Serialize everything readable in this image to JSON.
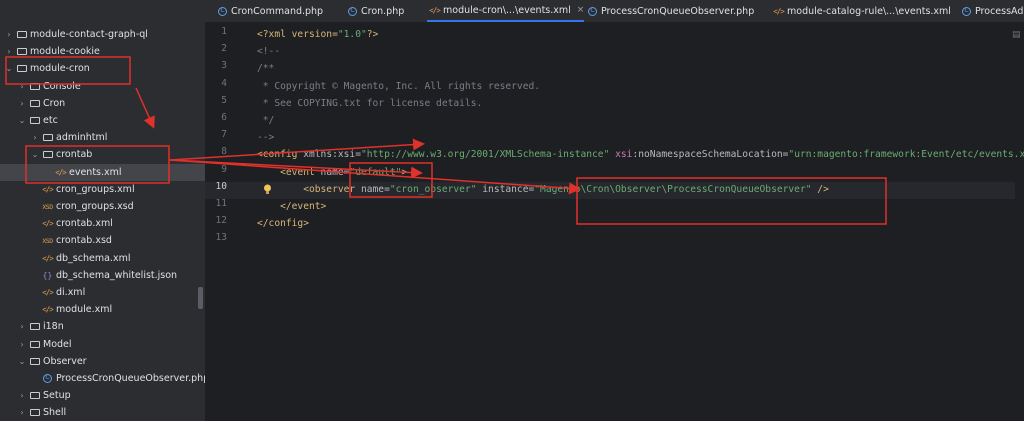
{
  "project_tree": {
    "items": [
      {
        "label": "module-contact-graph-ql",
        "type": "folder",
        "chevron": "›"
      },
      {
        "label": "module-cookie",
        "type": "folder",
        "chevron": "›"
      },
      {
        "label": "module-cron",
        "type": "folder",
        "chevron": "⌄"
      },
      {
        "label": "Console",
        "type": "folder",
        "chevron": "›"
      },
      {
        "label": "Cron",
        "type": "folder",
        "chevron": "›"
      },
      {
        "label": "etc",
        "type": "folder",
        "chevron": "⌄"
      },
      {
        "label": "adminhtml",
        "type": "folder",
        "chevron": "›"
      },
      {
        "label": "crontab",
        "type": "folder",
        "chevron": "⌄"
      },
      {
        "label": "events.xml",
        "type": "xml",
        "chevron": ""
      },
      {
        "label": "cron_groups.xml",
        "type": "xml",
        "chevron": ""
      },
      {
        "label": "cron_groups.xsd",
        "type": "xsd",
        "chevron": ""
      },
      {
        "label": "crontab.xml",
        "type": "xml",
        "chevron": ""
      },
      {
        "label": "crontab.xsd",
        "type": "xsd",
        "chevron": ""
      },
      {
        "label": "db_schema.xml",
        "type": "xml",
        "chevron": ""
      },
      {
        "label": "db_schema_whitelist.json",
        "type": "json",
        "chevron": ""
      },
      {
        "label": "di.xml",
        "type": "xml",
        "chevron": ""
      },
      {
        "label": "module.xml",
        "type": "xml",
        "chevron": ""
      },
      {
        "label": "i18n",
        "type": "folder",
        "chevron": "›"
      },
      {
        "label": "Model",
        "type": "folder",
        "chevron": "›"
      },
      {
        "label": "Observer",
        "type": "folder",
        "chevron": "⌄"
      },
      {
        "label": "ProcessCronQueueObserver.php",
        "type": "class",
        "chevron": ""
      },
      {
        "label": "Setup",
        "type": "folder",
        "chevron": "›"
      },
      {
        "label": "Shell",
        "type": "folder",
        "chevron": "›"
      }
    ],
    "selected_index": 8
  },
  "tabs": [
    {
      "label": "CronCommand.php",
      "icon": "class",
      "active": false
    },
    {
      "label": "Cron.php",
      "icon": "class",
      "active": false
    },
    {
      "label": "module-cron\\...\\events.xml",
      "icon": "xml",
      "active": true,
      "close": "×"
    },
    {
      "label": "ProcessCronQueueObserver.php",
      "icon": "class",
      "active": false
    },
    {
      "label": "module-catalog-rule\\...\\events.xml",
      "icon": "xml",
      "active": false
    },
    {
      "label": "ProcessAdm",
      "icon": "class",
      "active": false
    }
  ],
  "icons": {
    "xml": "</>",
    "xsd": "XSD",
    "json": "{}",
    "class": "C",
    "bulb": "lightbulb-icon"
  },
  "editor": {
    "current_line": 10,
    "line_numbers": [
      "1",
      "2",
      "3",
      "4",
      "5",
      "6",
      "7",
      "8",
      "9",
      "10",
      "11",
      "12",
      "13"
    ],
    "lines": [
      [
        {
          "t": "<?xml version=",
          "c": "tag"
        },
        {
          "t": "\"1.0\"",
          "c": "val"
        },
        {
          "t": "?>",
          "c": "tag"
        }
      ],
      [
        {
          "t": "<!--",
          "c": "com"
        }
      ],
      [
        {
          "t": "/**",
          "c": "com"
        }
      ],
      [
        {
          "t": " * Copyright © Magento, Inc. All rights reserved.",
          "c": "com"
        }
      ],
      [
        {
          "t": " * See COPYING.txt for license details.",
          "c": "com"
        }
      ],
      [
        {
          "t": " */",
          "c": "com"
        }
      ],
      [
        {
          "t": "-->",
          "c": "com"
        }
      ],
      [
        {
          "t": "<config ",
          "c": "tag"
        },
        {
          "t": "xmlns:xsi=",
          "c": "attr"
        },
        {
          "t": "\"http://www.w3.org/2001/XMLSchema-instance\"",
          "c": "val"
        },
        {
          "t": " xsi",
          "c": "ns"
        },
        {
          "t": ":noNamespaceSchemaLocation=",
          "c": "attr"
        },
        {
          "t": "\"urn:magento:framework:Event/etc/events.xsd\"",
          "c": "val"
        },
        {
          "t": ">",
          "c": "tag"
        }
      ],
      [
        {
          "t": "    <event ",
          "c": "tag"
        },
        {
          "t": "name=",
          "c": "attr"
        },
        {
          "t": "\"default\"",
          "c": "val"
        },
        {
          "t": ">",
          "c": "tag"
        }
      ],
      [
        {
          "t": "        <observer ",
          "c": "tag"
        },
        {
          "t": "name=",
          "c": "attr"
        },
        {
          "t": "\"cron_observer\"",
          "c": "val"
        },
        {
          "t": " instance=",
          "c": "attr"
        },
        {
          "t": "\"Magento\\Cron\\Observer\\ProcessCronQueueObserver\"",
          "c": "val"
        },
        {
          "t": " />",
          "c": "tag"
        }
      ],
      [
        {
          "t": "    </event>",
          "c": "tag"
        }
      ],
      [
        {
          "t": "</config>",
          "c": "tag"
        }
      ],
      []
    ]
  },
  "colors": {
    "annotation": "#e0312b",
    "accent": "#3574f0"
  }
}
